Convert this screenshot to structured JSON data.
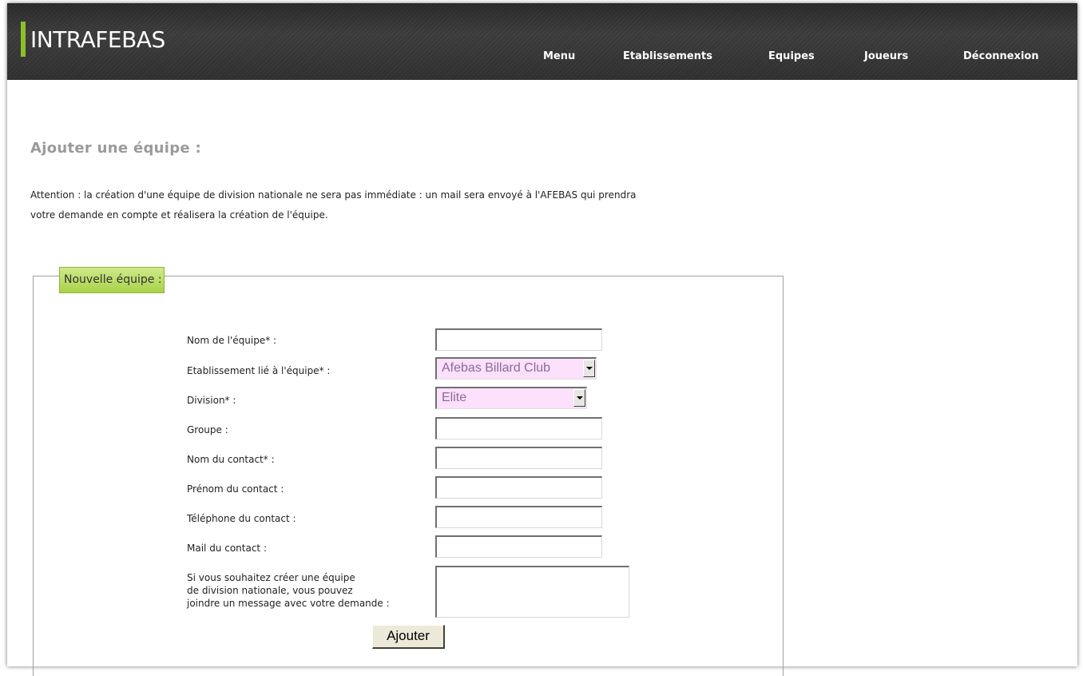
{
  "header": {
    "logo_text": "INTRAFEBAS",
    "accent_color": "#8dbf2a",
    "nav": [
      {
        "label": "Menu"
      },
      {
        "label": "Etablissements"
      },
      {
        "label": "Equipes"
      },
      {
        "label": "Joueurs"
      },
      {
        "label": "Déconnexion"
      }
    ]
  },
  "page": {
    "title": "Ajouter une équipe :",
    "notice_line1": "Attention : la création d'une équipe de division nationale ne sera pas immédiate : un mail sera envoyé à l'AFEBAS qui prendra",
    "notice_line2": "votre demande en compte et réalisera la création de l'équipe."
  },
  "form": {
    "legend": "Nouvelle équipe :",
    "fields": {
      "team_name": {
        "label": "Nom de l'équipe* :",
        "value": ""
      },
      "establishment": {
        "label": "Etablissement lié à l'équipe* :",
        "selected": "Afebas Billard Club"
      },
      "division": {
        "label": "Division* :",
        "selected": "Elite"
      },
      "group": {
        "label": "Groupe :",
        "value": ""
      },
      "contact_name": {
        "label": "Nom du contact* :",
        "value": ""
      },
      "contact_firstname": {
        "label": "Prénom du contact :",
        "value": ""
      },
      "contact_phone": {
        "label": "Téléphone du contact :",
        "value": ""
      },
      "contact_mail": {
        "label": "Mail du contact :",
        "value": ""
      },
      "message": {
        "label_line1": "Si vous souhaitez créer une équipe",
        "label_line2": "de division nationale, vous pouvez",
        "label_line3": "joindre un message avec votre demande :",
        "value": ""
      }
    },
    "submit_label": "Ajouter"
  }
}
